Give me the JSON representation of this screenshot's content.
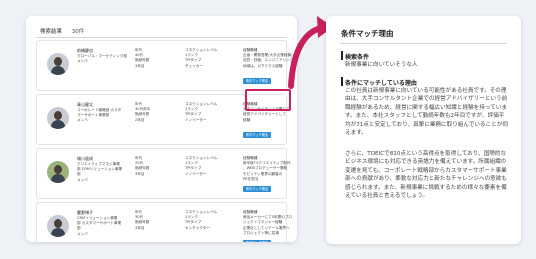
{
  "results": {
    "title": "検索結果",
    "count": "30件",
    "cards": [
      {
        "name": "前橋慶也",
        "desc": [
          "グローバル・マーケティング部",
          "メンバ"
        ],
        "col1": [
          "年代",
          "40代",
          "勤続年数",
          "3年目"
        ],
        "col2": [
          "コネクションレベル",
          "1ランク",
          "TPIタイプ",
          "チェッカー"
        ],
        "col3": [
          "経験職種",
          "企画・開発営業(大手企業経験)",
          "品質・評価、エンジニアリング",
          "地域は、以下ミクス経験"
        ],
        "button": "条件マッチ理由",
        "avatar_style": "plain"
      },
      {
        "name": "青山健太",
        "desc": [
          "コーポレート戦略部 カスタ",
          "マーサポート事業部",
          "メンバ"
        ],
        "col1": [
          "年代",
          "30代前半",
          "勤続年数",
          "2年目"
        ],
        "col2": [
          "コネクションレベル",
          "1ランク",
          "TPIタイプ",
          "イノベーター"
        ],
        "col3": [
          "経験職種",
          "大手コンサルタント企業にて",
          "経営アドバイザリーとして",
          "経験"
        ],
        "button": "条件マッチ理由",
        "avatar_style": "plain"
      },
      {
        "name": "城川遥成",
        "desc": [
          "クリエイティブマネジ事業",
          "部 CRMソリューション事業",
          "部",
          "メンバ"
        ],
        "col1": [
          "年代",
          "20代",
          "勤続年数",
          "3年目"
        ],
        "col2": [
          "コネクションレベル",
          "1ランク",
          "TPIタイプ",
          "イノベーター"
        ],
        "col3": [
          "経験職種",
          "新卒後TVクリエイティブ制作",
          "、WEBプロデューサー業務",
          "モビリティ業界の顧客の",
          "PRを担当"
        ],
        "button": "条件マッチ理由",
        "avatar_style": "outdoor"
      },
      {
        "name": "麓野博子",
        "desc": [
          "CRMソリューション事業",
          "部 カスタマーサポート事業",
          "部",
          "メンバ"
        ],
        "col1": [
          "年代",
          "30代",
          "勤続年数",
          "3年目"
        ],
        "col2": [
          "コネクションレベル",
          "1ランク",
          "TPIタイプ",
          "ヤンチャクター"
        ],
        "col3": [
          "経験職種",
          "食品メーカーにて5年間のブロ",
          "ジェクトマネジャー経験",
          "企業社としてリテール業界へ",
          "プロジェクト等に従事"
        ],
        "button": "条件マッチ理由",
        "avatar_style": "plain"
      }
    ]
  },
  "reason": {
    "title": "条件マッチ理由",
    "sections": [
      {
        "heading": "検索条件",
        "body": "新規事業に向いていそうな人"
      },
      {
        "heading": "条件にマッチしている理由",
        "body": "この社員は新規事業に向いている可能性がある社員です。その理由は、大手コンサルタント企業での経営アドバイザリーという前職経験があるため、経営に関する幅広い知識と経験を持っています。また、本社スタッフとして勤続年数も2年目ですが、評価平均が71点と安定しており、真摯に業務に取り組んでいることが伺えます。"
      },
      {
        "heading": "",
        "body": "さらに、TOEICで810点という高得点を取得しており、国際的なビジネス環境にも対応できる英語力を備えています。所属組織の変遷を見ても、コーポレート戦略部からカスタマーサポート事業部への貢献があり、柔軟な対応力と新たなチャレンジへの意欲も感じられます。また、新規事業に挑戦するための様々な要素を備えている社員と言えるでしょう。"
      }
    ]
  },
  "colors": {
    "accent": "#2b8fd6",
    "highlight": "#c7205a"
  }
}
